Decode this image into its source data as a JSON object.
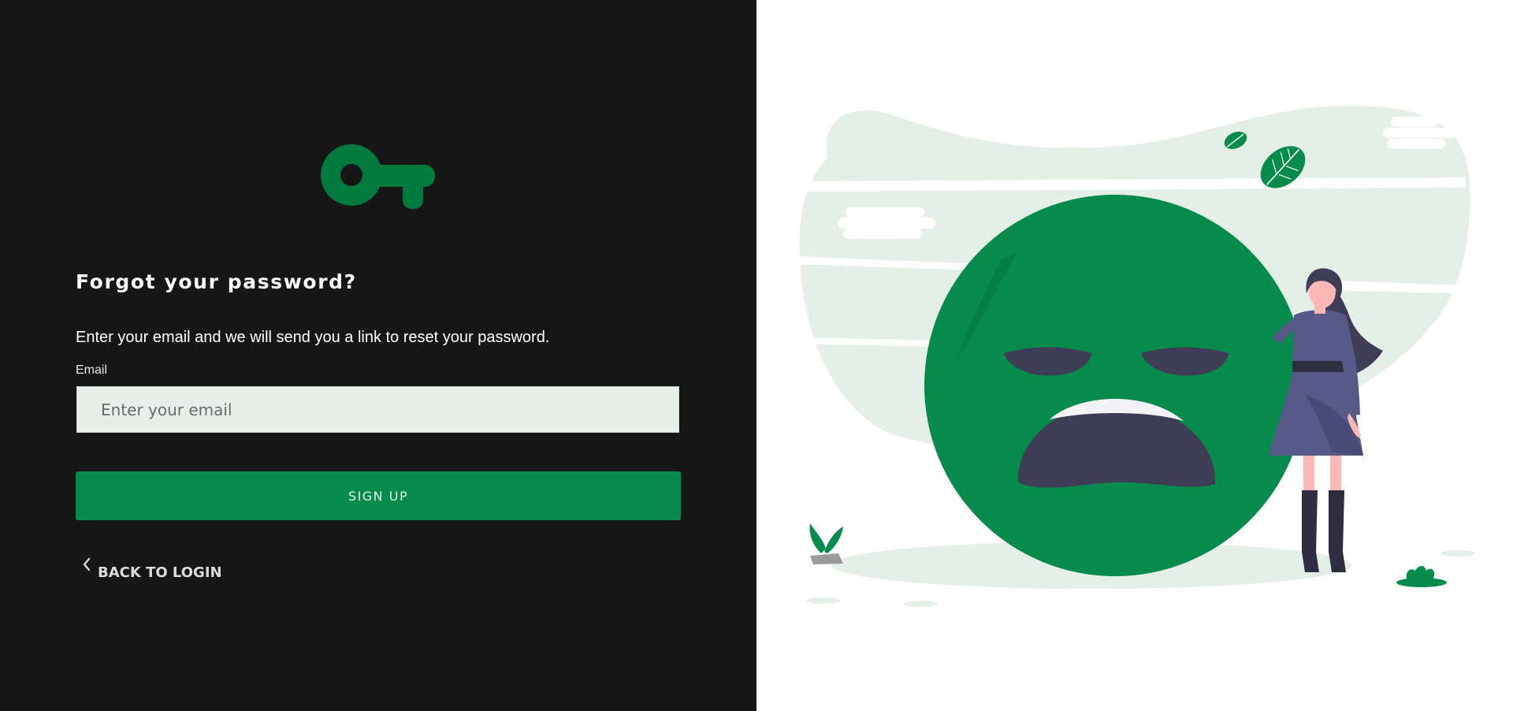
{
  "form": {
    "title": "Forgot your password?",
    "description": "Enter your email and we will send you a link to reset your password.",
    "email_label": "Email",
    "email_placeholder": "Enter your email",
    "email_value": "",
    "submit_label": "SIGN UP",
    "back_label": "BACK TO LOGIN"
  },
  "icons": {
    "logo": "key-icon",
    "back": "chevron-left-icon"
  },
  "colors": {
    "left_background": "#161616",
    "accent_green": "#058b4b",
    "logo_green": "#007a3d",
    "input_background": "#e8efeb",
    "right_background": "#ffffff"
  }
}
